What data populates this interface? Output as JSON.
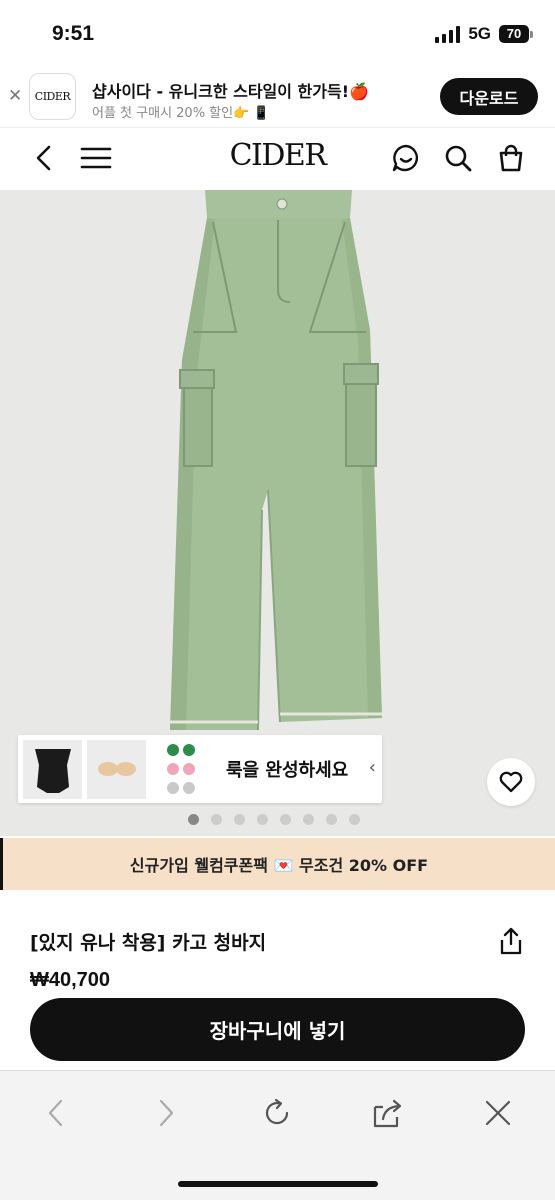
{
  "status_bar": {
    "time": "9:51",
    "network": "5G",
    "battery": "70"
  },
  "app_banner": {
    "logo_text": "CIDER",
    "title": "샵사이다 - 유니크한 스타일이 한가득!🍎",
    "subtitle": "어플 첫 구매시 20% 할인👉 📱",
    "download_label": "다운로드"
  },
  "header": {
    "logo": "CIDER"
  },
  "gallery": {
    "look_label": "룩을 완성하세요",
    "slide_count": 8,
    "active_slide": 1
  },
  "promo": {
    "text": "신규가입 웰컴쿠폰팩 💌 무조건 20% OFF"
  },
  "product": {
    "title": "[있지 유나 착용] 카고 청바지",
    "price": "₩40,700",
    "cart_label": "장바구니에 넣기"
  },
  "colors": {
    "accent": "#111111",
    "promo_bg": "#f6e1c8",
    "pants": "#a3bf98"
  },
  "icons": [
    "close-icon",
    "back-arrow-icon",
    "menu-icon",
    "chat-icon",
    "search-icon",
    "shopping-bag-icon",
    "heart-icon",
    "share-icon",
    "browser-back-icon",
    "browser-forward-icon",
    "reload-icon",
    "browser-share-icon",
    "browser-close-icon"
  ]
}
